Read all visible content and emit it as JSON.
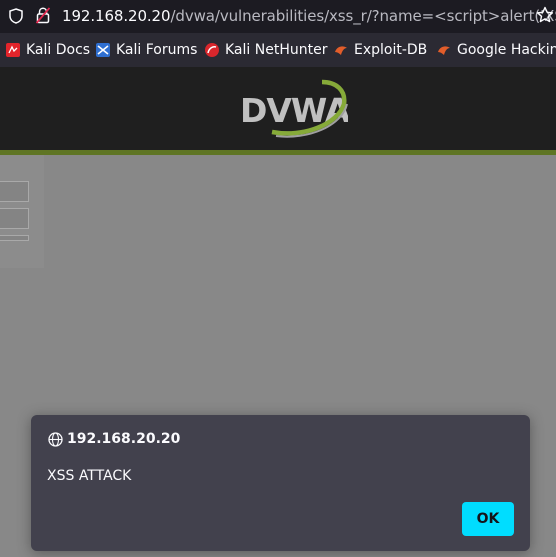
{
  "browser": {
    "url_host": "192.168.20.20",
    "url_path": "/dvwa/vulnerabilities/xss_r/?name=<script>alert('XSS+",
    "bookmarks": [
      {
        "label": "Kali Docs",
        "icon": "kali-docs-icon",
        "color": "#e3242b"
      },
      {
        "label": "Kali Forums",
        "icon": "kali-forums-icon",
        "color": "#2f6fd1"
      },
      {
        "label": "Kali NetHunter",
        "icon": "kali-nethunter-icon",
        "color": "#d8262c"
      },
      {
        "label": "Exploit-DB",
        "icon": "exploit-db-icon",
        "color": "#e25d2a"
      },
      {
        "label": "Google Hacking",
        "icon": "google-hacking-icon",
        "color": "#e25d2a"
      }
    ]
  },
  "page": {
    "logo_text": "DVWA"
  },
  "dialog": {
    "origin": "192.168.20.20",
    "message": "XSS ATTACK",
    "ok_label": "OK"
  },
  "colors": {
    "accent": "#00ddff",
    "dvwa_green": "#637a26",
    "dialog_bg": "#42414d"
  }
}
